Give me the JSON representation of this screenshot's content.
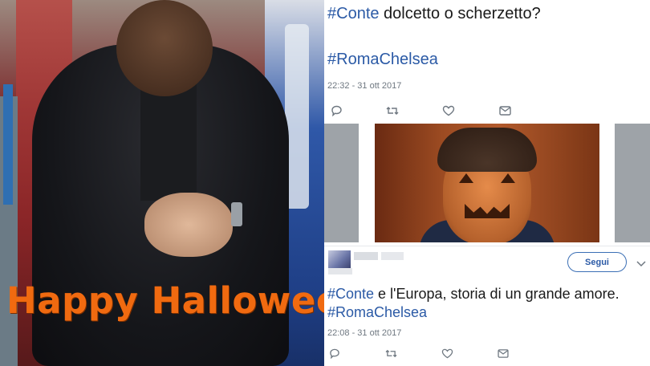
{
  "left_image": {
    "caption": "Happy Halloween",
    "caption_color": "#f06a10"
  },
  "tweet1": {
    "hashtag": "#Conte",
    "text": " dolcetto o scherzetto?",
    "hashtag2": "#RomaChelsea",
    "timestamp": "22:32 - 31 ott 2017",
    "actions": [
      "reply-icon",
      "retweet-icon",
      "like-icon",
      "message-icon"
    ]
  },
  "tweet2": {
    "follow_label": "Segui",
    "hashtag": "#Conte",
    "text": " e l'Europa, storia di un grande amore.",
    "hashtag2": "#RomaChelsea",
    "timestamp": "22:08 - 31 ott 2017",
    "actions": [
      "reply-icon",
      "retweet-icon",
      "like-icon",
      "message-icon"
    ]
  },
  "colors": {
    "hashtag": "#2b5aa6",
    "muted": "#6e7780",
    "follow_border": "#3b6fb5"
  }
}
